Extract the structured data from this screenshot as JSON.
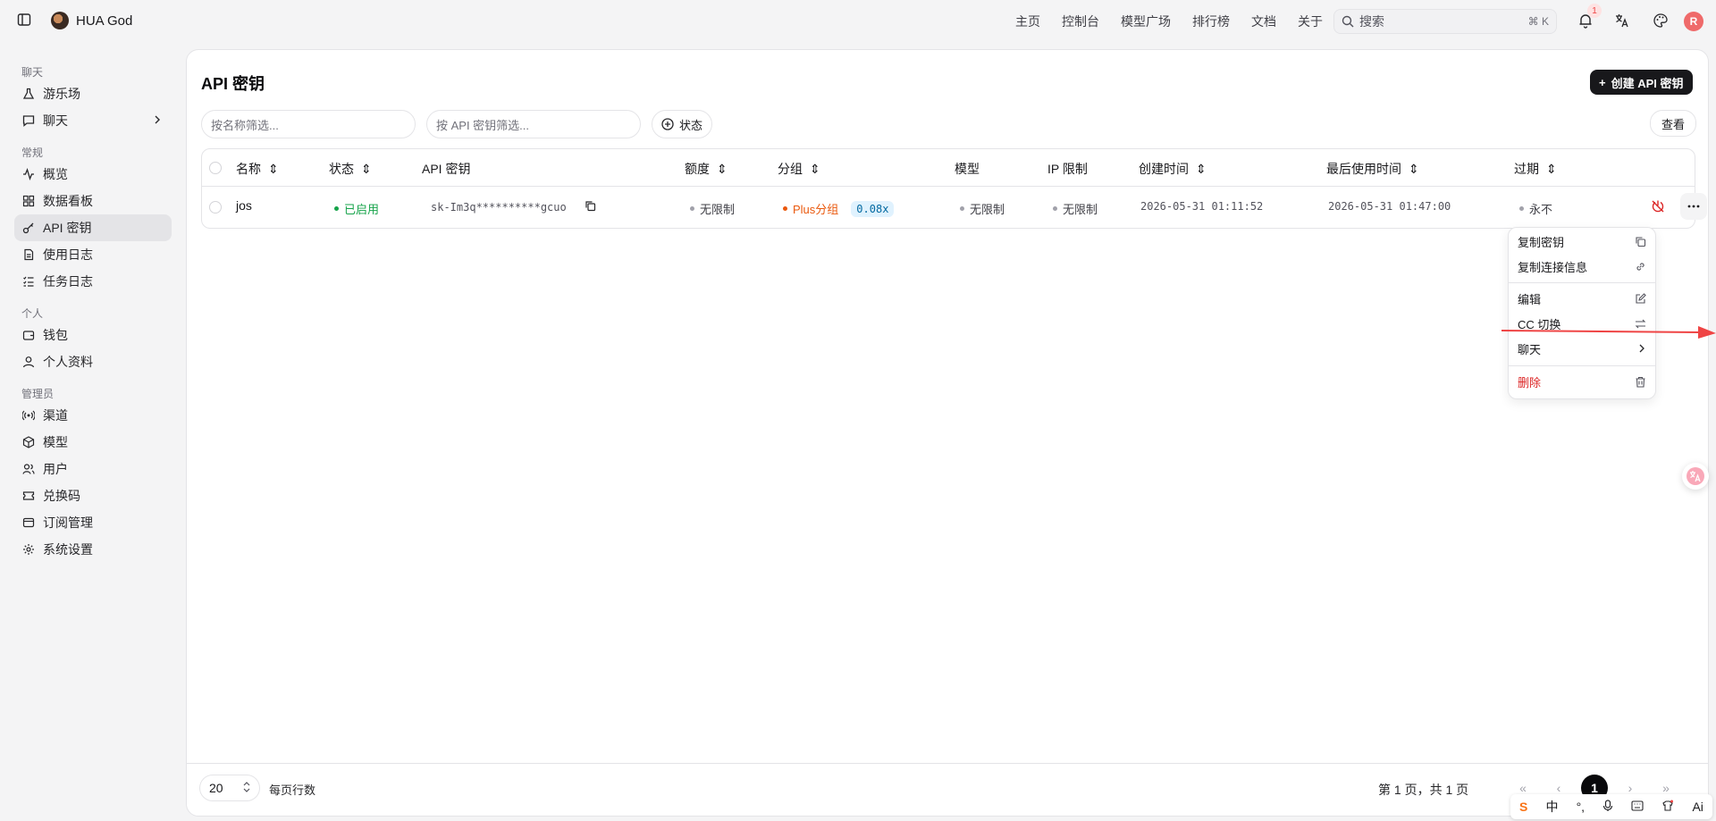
{
  "brand": {
    "name": "HUA God"
  },
  "nav": [
    "主页",
    "控制台",
    "模型广场",
    "排行榜",
    "文档",
    "关于"
  ],
  "search": {
    "placeholder": "搜索",
    "shortcut": "⌘ K"
  },
  "notifications": {
    "count": "1"
  },
  "user": {
    "initial": "R"
  },
  "sidebar": {
    "groups": [
      {
        "label": "聊天",
        "items": [
          {
            "label": "游乐场",
            "icon": "flask-icon"
          },
          {
            "label": "聊天",
            "icon": "message-icon",
            "has_submenu": true
          }
        ]
      },
      {
        "label": "常规",
        "items": [
          {
            "label": "概览",
            "icon": "activity-icon"
          },
          {
            "label": "数据看板",
            "icon": "grid-icon"
          },
          {
            "label": "API 密钥",
            "icon": "key-icon",
            "active": true
          },
          {
            "label": "使用日志",
            "icon": "log-icon"
          },
          {
            "label": "任务日志",
            "icon": "tasks-icon"
          }
        ]
      },
      {
        "label": "个人",
        "items": [
          {
            "label": "钱包",
            "icon": "wallet-icon"
          },
          {
            "label": "个人资料",
            "icon": "user-icon"
          }
        ]
      },
      {
        "label": "管理员",
        "items": [
          {
            "label": "渠道",
            "icon": "radio-icon"
          },
          {
            "label": "模型",
            "icon": "cube-icon"
          },
          {
            "label": "用户",
            "icon": "users-icon"
          },
          {
            "label": "兑换码",
            "icon": "ticket-icon"
          },
          {
            "label": "订阅管理",
            "icon": "card-icon"
          },
          {
            "label": "系统设置",
            "icon": "gear-icon"
          }
        ]
      }
    ]
  },
  "page": {
    "title": "API 密钥",
    "create_label": "创建 API 密钥",
    "filter_name_placeholder": "按名称筛选...",
    "filter_key_placeholder": "按 API 密钥筛选...",
    "status_filter_label": "状态",
    "view_label": "查看"
  },
  "table": {
    "columns": [
      "名称",
      "状态",
      "API 密钥",
      "额度",
      "分组",
      "模型",
      "IP 限制",
      "创建时间",
      "最后使用时间",
      "过期"
    ],
    "rows": [
      {
        "name": "jos",
        "status": "已启用",
        "key": "sk-Im3q**********gcuo",
        "quota": "无限制",
        "group": "Plus分组",
        "ratio": "0.08x",
        "models": "无限制",
        "ip_limit": "无限制",
        "created": "2026-05-31 01:11:52",
        "last_used": "2026-05-31 01:47:00",
        "expires": "永不"
      }
    ]
  },
  "menu": {
    "copy_key": "复制密钥",
    "copy_conn": "复制连接信息",
    "edit": "编辑",
    "cc_switch": "CC 切换",
    "chat": "聊天",
    "delete": "删除"
  },
  "footer": {
    "page_size": "20",
    "rows_per_page": "每页行数",
    "page_info": "第 1 页，共 1 页",
    "current_page": "1"
  },
  "ime": {
    "lang": "中",
    "ai": "Ai"
  },
  "colors": {
    "accent": "#18181b",
    "enabled": "#16a34a",
    "group": "#ea580c",
    "danger": "#dc2626",
    "arrow": "#ef4444"
  }
}
